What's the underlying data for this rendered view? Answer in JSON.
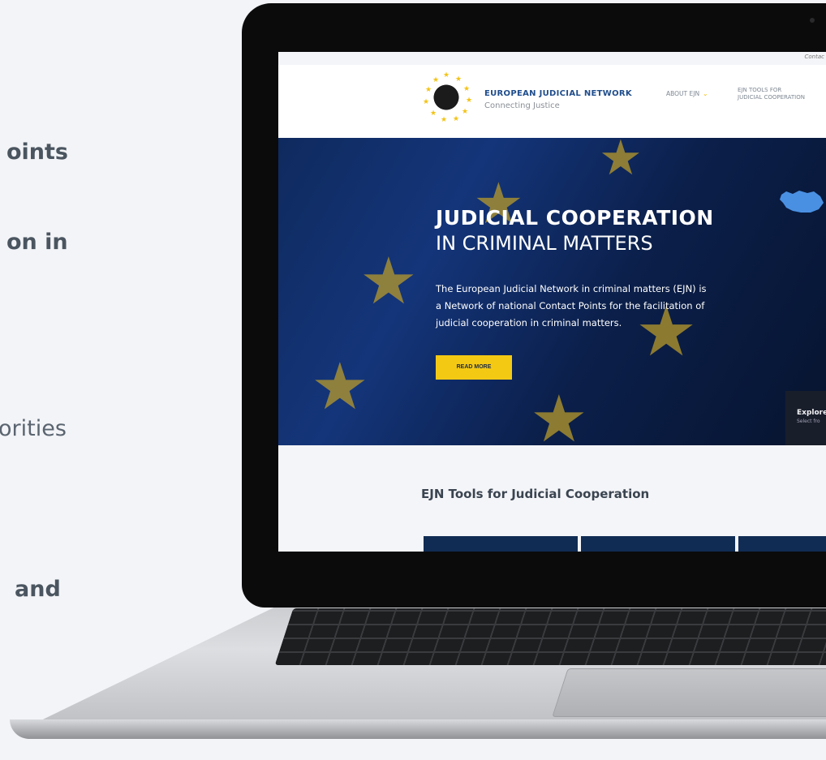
{
  "side_text": [
    {
      "text": "oints",
      "style": "bold"
    },
    {
      "text": "on in",
      "style": "bold"
    },
    {
      "text": "orities",
      "style": "light"
    },
    {
      "text": "and",
      "style": "bold"
    }
  ],
  "site": {
    "topbar": {
      "contact": "Contac"
    },
    "brand": {
      "title": "EUROPEAN JUDICIAL NETWORK",
      "subtitle": "Connecting Justice"
    },
    "nav": {
      "about": "ABOUT EJN",
      "tools_line1": "EJN TOOLS FOR",
      "tools_line2": "JUDICIAL COOPERATION"
    },
    "hero": {
      "title_bold": "JUDICIAL COOPERATION",
      "title_light": "IN CRIMINAL MATTERS",
      "text": "The European Judicial Network in criminal matters (EJN) is a Network of national Contact Points for the facilitation of judicial cooperation in criminal matters.",
      "button": "READ MORE",
      "explore_title": "Explore",
      "explore_sub": "Select fro"
    },
    "tools_heading": "EJN Tools for Judicial Cooperation"
  },
  "colors": {
    "brand_blue": "#1f4d8c",
    "accent_yellow": "#f4c914",
    "hero_navy": "#0f2a5e",
    "card_navy": "#102c54"
  }
}
